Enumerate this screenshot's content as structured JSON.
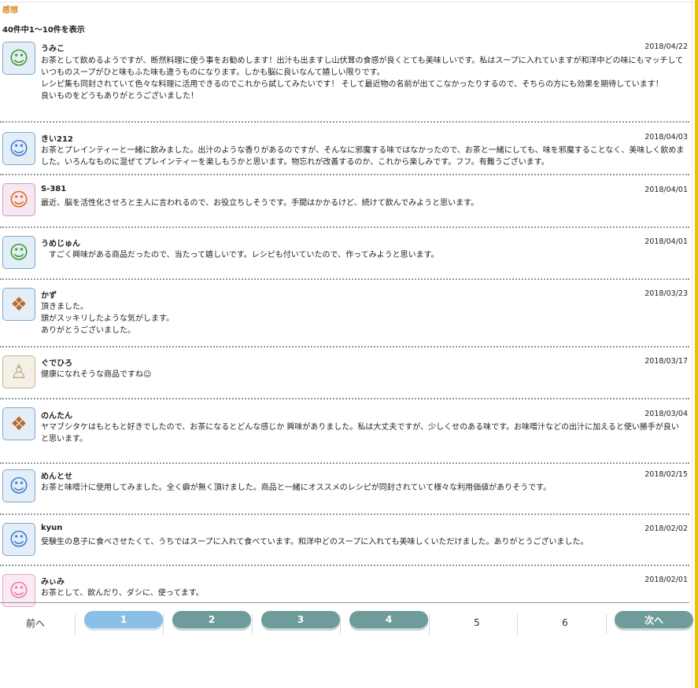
{
  "section_title": "感想",
  "result_count": "40件中1～10件を表示",
  "reviews": [
    {
      "name": "うみこ",
      "date": "2018/04/22",
      "avatar_icon": "green-character-icon",
      "body": [
        "お茶として飲めるようですが、断然料理に使う事をお勧めします！出汁も出ますし山伏茸の食感が良くとても美味しいです。私はスープに入れていますが和洋中どの味にもマッチしていつものスープがひと味もふた味も違うものになります。しかも脳に良いなんて嬉しい限りです。",
        "レシピ集も同封されていて色々な料理に活用できるのでこれから試してみたいです！ そして最近物の名前が出てこなかったりするので、そちらの方にも効果を期待しています！",
        "良いものをどうもありがとうございました！"
      ]
    },
    {
      "name": "きい212",
      "date": "2018/04/03",
      "avatar_icon": "blue-cat-icon",
      "body": [
        "お茶とプレインティーと一緒に飲みました。出汁のような香りがあるのですが、そんなに邪魔する味ではなかったので、お茶と一緒にしても、味を邪魔することなく、美味しく飲めました。いろんなものに混ぜてプレインティーを楽しもうかと思います。物忘れが改善するのか、これから楽しみです。フフ。有難うございます。"
      ]
    },
    {
      "name": "S-381",
      "date": "2018/04/01",
      "avatar_icon": "orange-cat-icon",
      "body": [
        "最近、脳を活性化させろと主人に言われるので、お役立ちしそうです。手間はかかるけど、続けて飲んでみようと思います。"
      ]
    },
    {
      "name": "うめじゅん",
      "date": "2018/04/01",
      "avatar_icon": "green-character-icon",
      "body": [
        "　すごく興味がある商品だったので、当たって嬉しいです。レシピも付いていたので、作ってみようと思います。"
      ]
    },
    {
      "name": "かず",
      "date": "2018/03/23",
      "avatar_icon": "food-icon",
      "body": [
        "頂きました。",
        "頭がスッキリしたような気がします。",
        "ありがとうございました。"
      ]
    },
    {
      "name": "ぐでひろ",
      "date": "2018/03/17",
      "avatar_icon": "chef-icon",
      "body": [
        "健康になれそうな商品ですね☺"
      ]
    },
    {
      "name": "のんたん",
      "date": "2018/03/04",
      "avatar_icon": "food-icon",
      "body": [
        "ヤマブシタケはもともと好きでしたので、お茶になるとどんな感じか 興味がありました。私は大丈夫ですが、少しくせのある味です。お味噌汁などの出汁に加えると使い勝手が良いと思います。"
      ]
    },
    {
      "name": "めんとせ",
      "date": "2018/02/15",
      "avatar_icon": "blue-cat-icon",
      "body": [
        "お茶と味噌汁に使用してみました。全く癖が無く頂けました。商品と一緒にオススメのレシピが同封されていて様々な利用価値がありそうです。"
      ]
    },
    {
      "name": "kyun",
      "date": "2018/02/02",
      "avatar_icon": "blue-cat-icon",
      "body": [
        "受験生の息子に食べさせたくて、うちではスープに入れて食べています。和洋中どのスープに入れても美味しくいただけました。ありがとうございました。"
      ]
    },
    {
      "name": "みぃみ",
      "date": "2018/02/01",
      "avatar_icon": "pink-cat-icon",
      "body": [
        "お茶として、飲んだり、ダシに、使ってます。"
      ]
    }
  ],
  "pagination": {
    "prev": "前へ",
    "pages": [
      "1",
      "2",
      "3",
      "4",
      "5",
      "6"
    ],
    "current": "1",
    "next": "次へ"
  },
  "colors": {
    "section_title": "#d68a1c",
    "page_button": "#6d9c9a",
    "page_current": "#8cbfe6",
    "right_bar": "#e8c400"
  }
}
